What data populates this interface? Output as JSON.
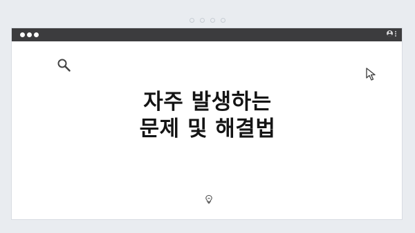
{
  "carousel": {
    "page_count": 4
  },
  "browser": {
    "window_controls": [
      "close",
      "minimize",
      "maximize"
    ],
    "toolbar_icons": [
      "profile-icon",
      "menu-dots-icon"
    ]
  },
  "content": {
    "headline_line1": "자주 발생하는",
    "headline_line2": "문제 및 해결법",
    "decorative_icons": [
      "search-icon",
      "cursor-icon",
      "lightbulb-icon"
    ]
  },
  "colors": {
    "background": "#e9ecf0",
    "titlebar": "#3c3c3e",
    "headline": "#141414",
    "icon_stroke": "#444444"
  }
}
